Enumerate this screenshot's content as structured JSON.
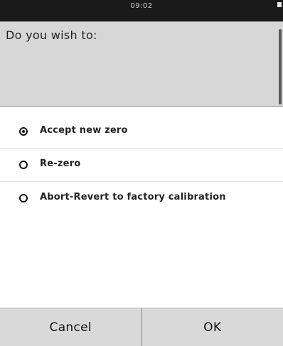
{
  "status_bar": {
    "time": "09:02",
    "battery_icon": "battery-icon"
  },
  "prompt": {
    "text": "Do you wish to:"
  },
  "options": [
    {
      "label": "Accept new zero",
      "selected": true
    },
    {
      "label": "Re-zero",
      "selected": false
    },
    {
      "label": "Abort-Revert to factory calibration",
      "selected": false
    }
  ],
  "buttons": {
    "cancel": "Cancel",
    "ok": "OK"
  }
}
